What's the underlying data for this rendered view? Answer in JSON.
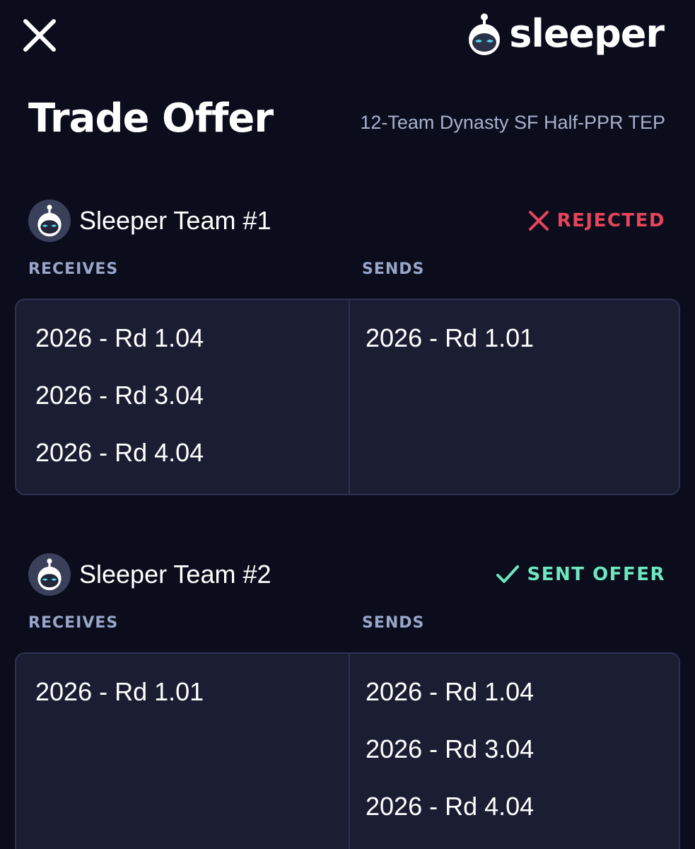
{
  "brand": {
    "name": "sleeper"
  },
  "header": {
    "title": "Trade Offer",
    "league": "12-Team Dynasty SF Half-PPR TEP"
  },
  "trades": [
    {
      "team": "Sleeper Team #1",
      "status": "REJECTED",
      "receives_label": "RECEIVES",
      "sends_label": "SENDS",
      "receives": [
        "2026 - Rd 1.04",
        "2026 - Rd 3.04",
        "2026 - Rd 4.04"
      ],
      "sends": [
        "2026 - Rd 1.01"
      ]
    },
    {
      "team": "Sleeper Team #2",
      "status": "SENT OFFER",
      "receives_label": "RECEIVES",
      "sends_label": "SENDS",
      "receives": [
        "2026 - Rd 1.01"
      ],
      "sends": [
        "2026 - Rd 1.04",
        "2026 - Rd 3.04",
        "2026 - Rd 4.04"
      ]
    }
  ],
  "colors": {
    "background": "#0b0d1d",
    "card": "#1b1d33",
    "rejected": "#e8445b",
    "sent": "#6ee7bf",
    "label": "#98a6c9"
  },
  "icons": {
    "close": "close-icon",
    "logo": "sleeper-robot-icon",
    "rejected": "x-icon",
    "sent": "check-icon"
  }
}
